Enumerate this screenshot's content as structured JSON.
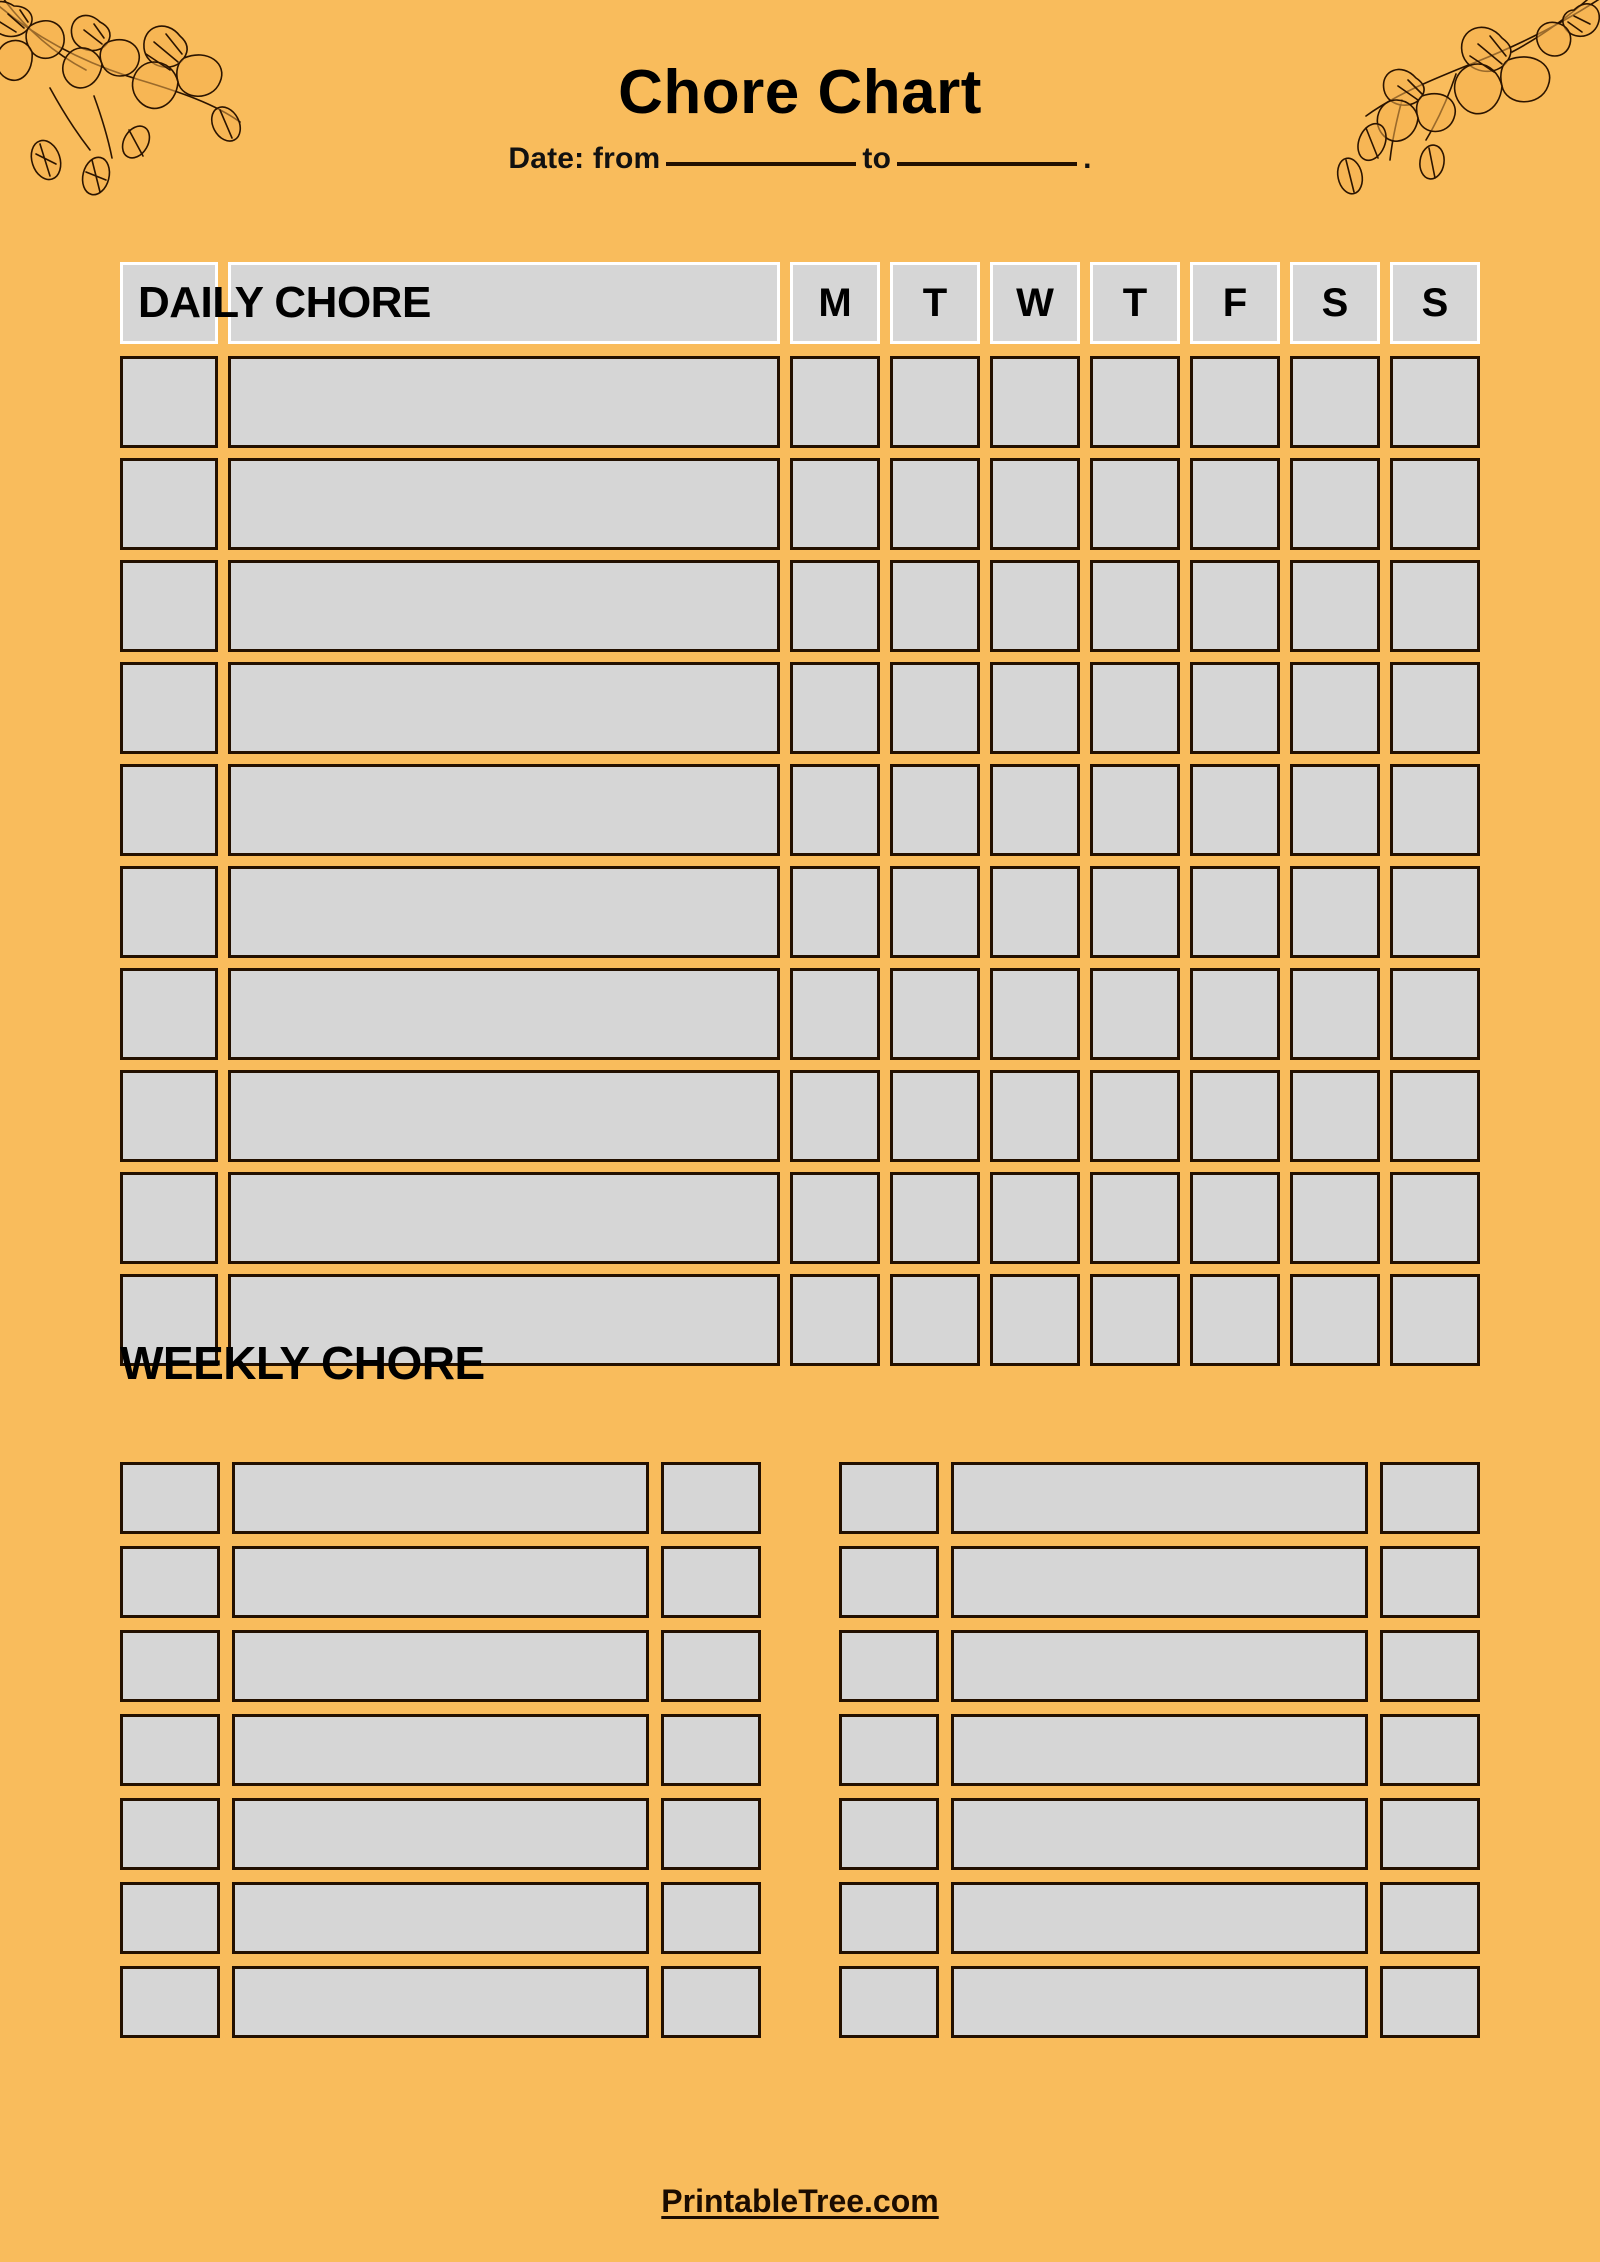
{
  "page": {
    "background_color": "#F9BC5C",
    "box_fill_color": "#D6D6D6",
    "box_border_color": "#231000"
  },
  "header": {
    "title": "Chore Chart",
    "date_prefix": "Date: from",
    "date_middle": "to",
    "date_suffix": ".",
    "decorations": [
      "floral-branch-top-left",
      "floral-branch-top-right"
    ]
  },
  "daily": {
    "section_label": "DAILY CHORE",
    "day_headers": [
      "M",
      "T",
      "W",
      "T",
      "F",
      "S",
      "S"
    ],
    "row_count": 10,
    "rows": [
      {
        "checkbox": "",
        "task": ""
      },
      {
        "checkbox": "",
        "task": ""
      },
      {
        "checkbox": "",
        "task": ""
      },
      {
        "checkbox": "",
        "task": ""
      },
      {
        "checkbox": "",
        "task": ""
      },
      {
        "checkbox": "",
        "task": ""
      },
      {
        "checkbox": "",
        "task": ""
      },
      {
        "checkbox": "",
        "task": ""
      },
      {
        "checkbox": "",
        "task": ""
      },
      {
        "checkbox": "",
        "task": ""
      }
    ]
  },
  "weekly": {
    "section_label": "WEEKLY CHORE",
    "column_count": 2,
    "rows_per_column": 7,
    "columns": [
      {
        "rows": [
          {
            "checkbox_left": "",
            "task": "",
            "checkbox_right": ""
          },
          {
            "checkbox_left": "",
            "task": "",
            "checkbox_right": ""
          },
          {
            "checkbox_left": "",
            "task": "",
            "checkbox_right": ""
          },
          {
            "checkbox_left": "",
            "task": "",
            "checkbox_right": ""
          },
          {
            "checkbox_left": "",
            "task": "",
            "checkbox_right": ""
          },
          {
            "checkbox_left": "",
            "task": "",
            "checkbox_right": ""
          },
          {
            "checkbox_left": "",
            "task": "",
            "checkbox_right": ""
          }
        ]
      },
      {
        "rows": [
          {
            "checkbox_left": "",
            "task": "",
            "checkbox_right": ""
          },
          {
            "checkbox_left": "",
            "task": "",
            "checkbox_right": ""
          },
          {
            "checkbox_left": "",
            "task": "",
            "checkbox_right": ""
          },
          {
            "checkbox_left": "",
            "task": "",
            "checkbox_right": ""
          },
          {
            "checkbox_left": "",
            "task": "",
            "checkbox_right": ""
          },
          {
            "checkbox_left": "",
            "task": "",
            "checkbox_right": ""
          },
          {
            "checkbox_left": "",
            "task": "",
            "checkbox_right": ""
          }
        ]
      }
    ]
  },
  "footer": {
    "site": "PrintableTree.com"
  }
}
